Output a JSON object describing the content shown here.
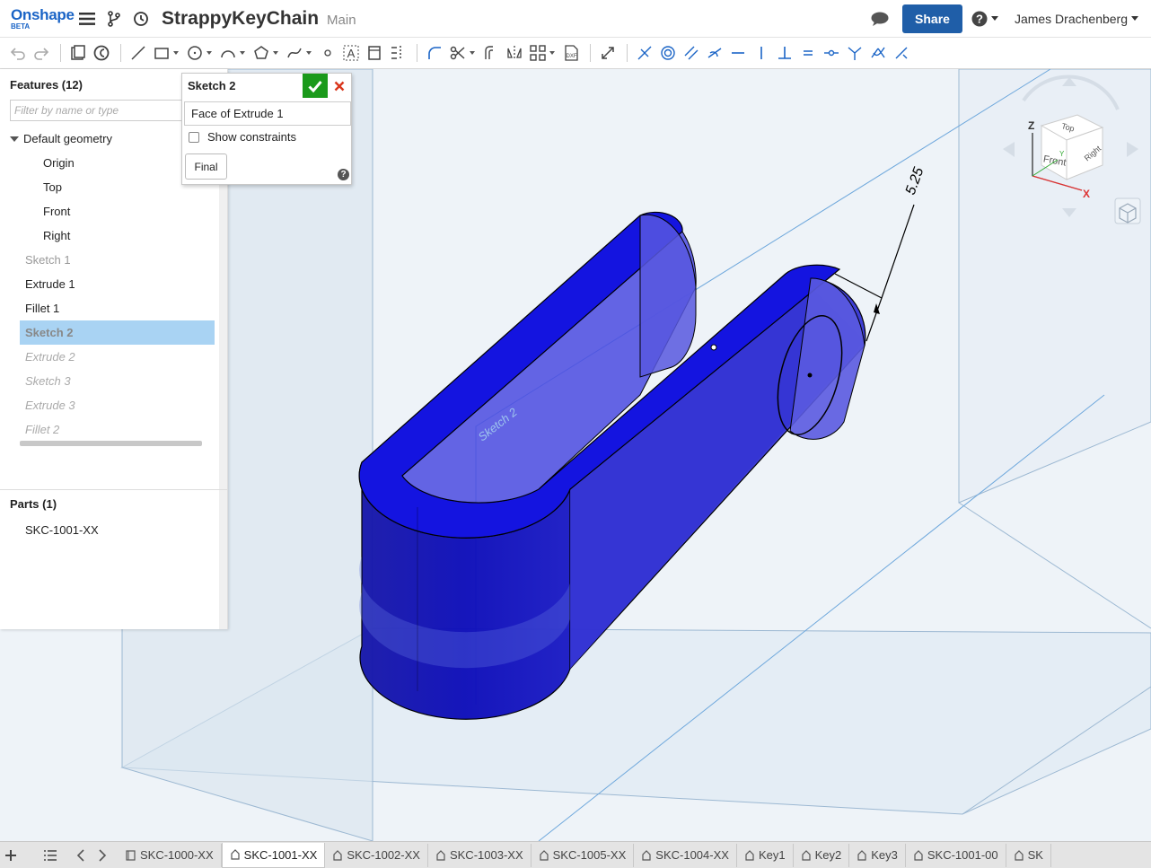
{
  "header": {
    "logo_name": "Onshape",
    "logo_beta": "BETA",
    "doc_title": "StrappyKeyChain",
    "branch": "Main",
    "share_label": "Share",
    "user_name": "James Drachenberg"
  },
  "features": {
    "title": "Features (12)",
    "filter_placeholder": "Filter by name or type",
    "group": "Default geometry",
    "planes": [
      "Origin",
      "Top",
      "Front",
      "Right"
    ],
    "items": [
      {
        "label": "Sketch 1",
        "state": "dim"
      },
      {
        "label": "Extrude 1",
        "state": "normal"
      },
      {
        "label": "Fillet 1",
        "state": "normal"
      },
      {
        "label": "Sketch 2",
        "state": "selected"
      },
      {
        "label": "Extrude 2",
        "state": "rolled"
      },
      {
        "label": "Sketch 3",
        "state": "rolled"
      },
      {
        "label": "Extrude 3",
        "state": "rolled"
      },
      {
        "label": "Fillet 2",
        "state": "rolled"
      }
    ],
    "parts_title": "Parts (1)",
    "parts": [
      "SKC-1001-XX"
    ]
  },
  "sketch_dialog": {
    "title": "Sketch 2",
    "face": "Face of Extrude 1",
    "show_constraints": "Show constraints",
    "final": "Final",
    "help": "?"
  },
  "viewport": {
    "dimension": "5.25",
    "sketch_label": "Sketch 2",
    "view_cube": {
      "top": "Top",
      "front": "Front",
      "right": "Right",
      "axis_z": "Z",
      "axis_x": "X",
      "axis_y": "Y"
    }
  },
  "tabs": {
    "items": [
      "SKC-1000-XX",
      "SKC-1001-XX",
      "SKC-1002-XX",
      "SKC-1003-XX",
      "SKC-1005-XX",
      "SKC-1004-XX",
      "Key1",
      "Key2",
      "Key3",
      "SKC-1001-00",
      "SK"
    ],
    "active_index": 1
  },
  "colors": {
    "brand": "#1a64c6",
    "share": "#1f5ea8",
    "part": "#1f1fd6",
    "selected": "#a9d3f3",
    "accept": "#1b9a1b"
  }
}
